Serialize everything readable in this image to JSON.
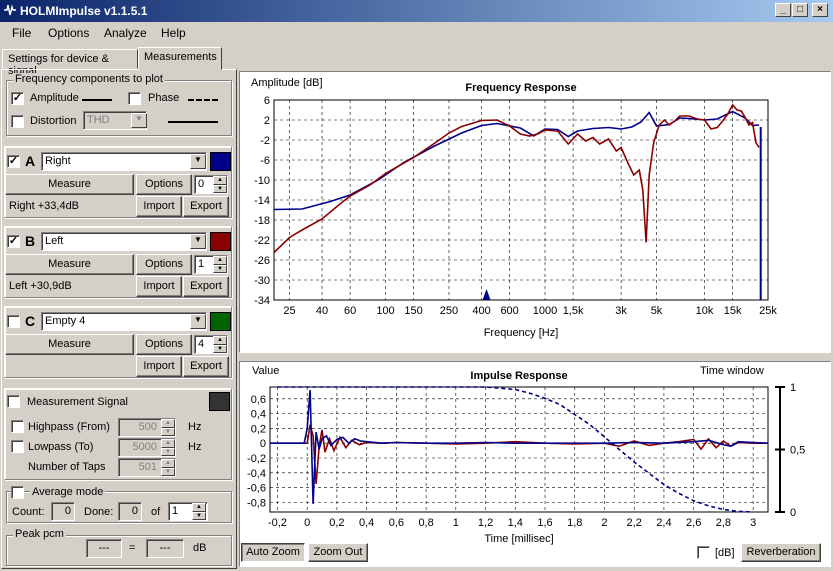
{
  "window": {
    "title": "HOLMImpulse  v1.1.5.1",
    "controls": {
      "minimize": "_",
      "maximize": "□",
      "close": "×"
    }
  },
  "menu": [
    "File",
    "Options",
    "Analyze",
    "Help"
  ],
  "tabs": [
    "Settings for device & signal",
    "Measurements"
  ],
  "freq_components": {
    "title": "Frequency components to plot",
    "amplitude_label": "Amplitude",
    "phase_label": "Phase",
    "distortion_label": "Distortion",
    "distortion_select": "THD"
  },
  "channels": [
    {
      "letter": "A",
      "checked": true,
      "name": "Right",
      "color": "#00008b",
      "measure_label": "Measure",
      "options_label": "Options",
      "spin_value": "0",
      "level": "Right +33,4dB",
      "import_label": "Import",
      "export_label": "Export"
    },
    {
      "letter": "B",
      "checked": true,
      "name": "Left",
      "color": "#8b0000",
      "measure_label": "Measure",
      "options_label": "Options",
      "spin_value": "1",
      "level": "Left +30,9dB",
      "import_label": "Import",
      "export_label": "Export"
    },
    {
      "letter": "C",
      "checked": false,
      "name": "Empty 4",
      "color": "#006400",
      "measure_label": "Measure",
      "options_label": "Options",
      "spin_value": "4",
      "level": "",
      "import_label": "Import",
      "export_label": "Export"
    }
  ],
  "measurement_signal": {
    "label": "Measurement Signal",
    "highpass_label": "Highpass (From)",
    "highpass_value": "500",
    "highpass_unit": "Hz",
    "lowpass_label": "Lowpass (To)",
    "lowpass_value": "5000",
    "lowpass_unit": "Hz",
    "taps_label": "Number of Taps",
    "taps_value": "501"
  },
  "average": {
    "title": "Average mode",
    "count_label": "Count:",
    "count_value": "0",
    "done_label": "Done:",
    "done_value": "0",
    "of_label": "of",
    "of_value": "1"
  },
  "peak": {
    "title": "Peak pcm",
    "left_value": "---",
    "equals": "=",
    "right_value": "---",
    "unit": "dB"
  },
  "bottom_controls": {
    "auto_zoom": "Auto Zoom",
    "zoom_out": "Zoom Out",
    "db_label": "[dB]",
    "reverberation": "Reverberation"
  },
  "chart_data": [
    {
      "type": "line",
      "title": "Frequency Response",
      "ylabel": "Amplitude [dB]",
      "xlabel": "Frequency [Hz]",
      "xscale": "log",
      "xlim": [
        20,
        25000
      ],
      "ylim": [
        -34,
        6
      ],
      "xticks": [
        25,
        40,
        60,
        100,
        150,
        250,
        400,
        600,
        1000,
        1500,
        3000,
        5000,
        10000,
        15000,
        25000
      ],
      "xtick_labels": [
        "25",
        "40",
        "60",
        "100",
        "150",
        "250",
        "400",
        "600",
        "1000",
        "1,5k",
        "3k",
        "5k",
        "10k",
        "15k",
        "25k"
      ],
      "yticks": [
        6,
        2,
        -2,
        -6,
        -10,
        -14,
        -18,
        -22,
        -26,
        -30,
        -34
      ],
      "ytick_labels": [
        "6",
        "2",
        "-2",
        "-6",
        "-10",
        "-14",
        "-18",
        "-22",
        "-26",
        "-30",
        "-34"
      ],
      "grid": true,
      "series": [
        {
          "color": "#00008b",
          "x": [
            20,
            30,
            45,
            60,
            90,
            130,
            200,
            300,
            400,
            500,
            700,
            850,
            1000,
            1200,
            1400,
            1600,
            2000,
            2500,
            3000,
            3500,
            4000,
            4500,
            5000,
            6000,
            7000,
            8000,
            10000,
            12000,
            15000,
            18000,
            20000,
            22000
          ],
          "y": [
            -15.9,
            -15.8,
            -14.3,
            -13.0,
            -10.0,
            -6.5,
            -3.3,
            -0.6,
            0.9,
            1.3,
            0.4,
            -1.2,
            0.2,
            0.1,
            -1.3,
            -0.2,
            0.3,
            0.5,
            0.2,
            0.6,
            1.6,
            3.5,
            0.8,
            1.1,
            2.4,
            2.3,
            2.0,
            2.2,
            3.7,
            2.4,
            0.9,
            1.0
          ]
        },
        {
          "color": "#8b0000",
          "x": [
            20,
            25,
            30,
            40,
            50,
            60,
            80,
            100,
            150,
            200,
            250,
            300,
            400,
            500,
            600,
            700,
            800,
            900,
            1000,
            1200,
            1400,
            1600,
            1800,
            2000,
            2200,
            2500,
            2800,
            3000,
            3300,
            3600,
            3900,
            4100,
            4300,
            4500,
            4800,
            5200,
            5600,
            6000,
            6500,
            7000,
            8000,
            9000,
            10000,
            11000,
            12000,
            13000,
            14000,
            15000,
            16000,
            17000,
            18000,
            19000,
            20000,
            21000,
            22000
          ],
          "y": [
            -24.5,
            -21.5,
            -20.0,
            -17.8,
            -15.2,
            -13.2,
            -11.0,
            -8.7,
            -5.5,
            -2.8,
            -0.6,
            0.7,
            1.9,
            2.0,
            0.8,
            -0.8,
            -1.2,
            -0.8,
            0.0,
            -0.2,
            -2.8,
            -0.8,
            -2.2,
            -1.5,
            -2.8,
            -1.8,
            -4.2,
            -3.5,
            -6.5,
            -9.0,
            -8.0,
            -12.0,
            -22.5,
            -9.0,
            -2.5,
            1.0,
            2.0,
            1.0,
            1.8,
            2.8,
            2.8,
            2.2,
            2.0,
            0.2,
            0.5,
            1.8,
            3.2,
            5.0,
            4.0,
            3.8,
            2.5,
            1.0,
            1.5,
            -2.5,
            -3.5
          ]
        }
      ]
    },
    {
      "type": "line",
      "title": "Impulse Response",
      "ylabel": "Value",
      "xlabel": "Time [millisec]",
      "right_axis_label": "Time window",
      "xlim": [
        -0.25,
        3.1
      ],
      "ylim": [
        -0.93,
        0.76
      ],
      "y2lim": [
        0,
        1
      ],
      "xticks": [
        -0.2,
        0,
        0.2,
        0.4,
        0.6,
        0.8,
        1,
        1.2,
        1.4,
        1.6,
        1.8,
        2,
        2.2,
        2.4,
        2.6,
        2.8,
        3
      ],
      "xtick_labels": [
        "-0,2",
        "0",
        "0,2",
        "0,4",
        "0,6",
        "0,8",
        "1",
        "1,2",
        "1,4",
        "1,6",
        "1,8",
        "2",
        "2,2",
        "2,4",
        "2,6",
        "2,8",
        "3"
      ],
      "yticks": [
        0.6,
        0.4,
        0.2,
        0,
        -0.2,
        -0.4,
        -0.6,
        -0.8
      ],
      "ytick_labels": [
        "0,6",
        "0,4",
        "0,2",
        "0",
        "-0,2",
        "-0,4",
        "-0,6",
        "-0,8"
      ],
      "y2ticks": [
        1,
        0.5,
        0
      ],
      "y2tick_labels": [
        "1",
        "0,5",
        "0"
      ],
      "grid": true,
      "series": [
        {
          "color": "#8b0000",
          "x": [
            -0.25,
            -0.1,
            0,
            0.02,
            0.04,
            0.06,
            0.08,
            0.1,
            0.12,
            0.15,
            0.18,
            0.22,
            0.26,
            0.3,
            0.35,
            0.4,
            0.5,
            0.6,
            0.8,
            1.0,
            1.2,
            1.4,
            1.6,
            1.8,
            2.0,
            2.1,
            2.2,
            2.3,
            2.4,
            2.5,
            2.6,
            2.65,
            2.7,
            2.75,
            2.8,
            2.85,
            2.9,
            3.0,
            3.1
          ],
          "y": [
            0,
            0,
            0,
            0.25,
            0.1,
            -0.55,
            -0.05,
            0.18,
            -0.12,
            0.06,
            -0.1,
            0.08,
            -0.06,
            0.04,
            -0.02,
            0.01,
            0.0,
            0.01,
            0.0,
            -0.01,
            0.0,
            0.02,
            0.0,
            -0.01,
            0.0,
            -0.04,
            0.03,
            -0.03,
            0.0,
            0.02,
            0.05,
            -0.08,
            0.06,
            -0.06,
            0.03,
            -0.04,
            0.01,
            0.0,
            0.0
          ]
        },
        {
          "color": "#00008b",
          "x": [
            -0.25,
            -0.1,
            -0.02,
            0,
            0.02,
            0.04,
            0.06,
            0.08,
            0.1,
            0.13,
            0.16,
            0.2,
            0.24,
            0.28,
            0.32,
            0.36,
            0.4,
            0.5,
            0.6,
            0.8,
            1.0,
            1.2,
            1.4,
            1.6,
            1.8,
            2.0,
            2.2,
            2.4,
            2.6,
            2.7,
            2.8,
            2.85,
            2.9,
            3.0,
            3.1
          ],
          "y": [
            0,
            0,
            0.0,
            0.2,
            0.72,
            -0.82,
            0.15,
            -0.08,
            0.06,
            0.1,
            -0.03,
            0.05,
            0.08,
            0.0,
            0.06,
            0.03,
            0.02,
            0.0,
            0.01,
            0.0,
            0.0,
            0.01,
            0.0,
            0.0,
            0.0,
            0.0,
            0.01,
            0.0,
            0.02,
            0.04,
            -0.02,
            -0.04,
            0.02,
            0.01,
            0.0
          ]
        },
        {
          "color": "#00008b",
          "dash": true,
          "axis": "y2",
          "x": [
            -0.2,
            0.0,
            0.3,
            0.6,
            0.9,
            1.2,
            1.4,
            1.5,
            1.6,
            1.7,
            1.8,
            1.9,
            2.0,
            2.1,
            2.2,
            2.3,
            2.4,
            2.5,
            2.6,
            2.7,
            2.8,
            2.9,
            3.0
          ],
          "y": [
            1,
            1,
            1,
            1,
            1,
            1,
            0.98,
            0.95,
            0.91,
            0.86,
            0.78,
            0.7,
            0.6,
            0.5,
            0.4,
            0.31,
            0.22,
            0.15,
            0.09,
            0.05,
            0.02,
            0.005,
            0.0
          ]
        }
      ]
    }
  ]
}
